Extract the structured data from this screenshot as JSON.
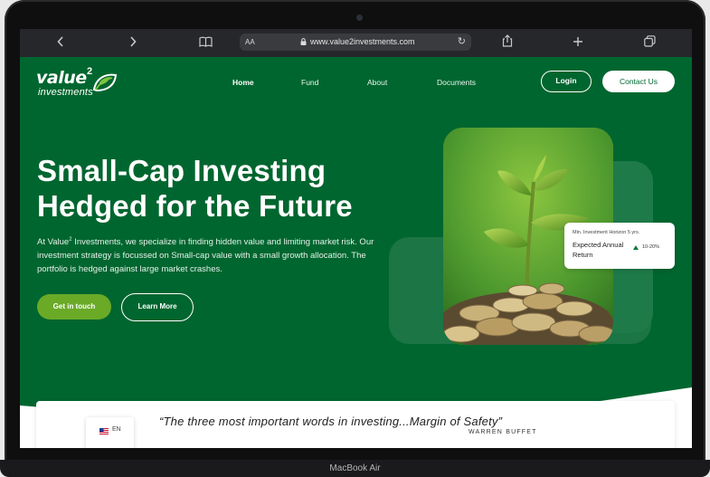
{
  "browser": {
    "text_size_label": "AA",
    "url": "www.value2investments.com"
  },
  "site": {
    "logo": {
      "word": "value",
      "sup": "2",
      "sub": "investments"
    },
    "nav": [
      {
        "label": "Home"
      },
      {
        "label": "Fund"
      },
      {
        "label": "About"
      },
      {
        "label": "Documents"
      }
    ],
    "login_label": "Login",
    "contact_label": "Contact Us"
  },
  "hero": {
    "title_line1": "Small-Cap Investing",
    "title_line2": "Hedged for the Future",
    "desc_pre": "At Value",
    "desc_sup": "2",
    "desc_post": " Investments, we specialize in finding hidden value and limiting market risk. Our investment strategy is focussed on Small-cap value with a small growth allocation. The portfolio is hedged against large market crashes.",
    "primary_button": "Get in touch",
    "secondary_button": "Learn More"
  },
  "stat_card": {
    "horizon": "Min. Investment Horizon 5 yrs.",
    "label": "Expected Annual Return",
    "range": "10-20%"
  },
  "quote": {
    "lang": "EN",
    "text": "“The three most important words in investing...Margin of Safety”",
    "author": "WARREN BUFFET"
  },
  "device": {
    "label": "MacBook Air"
  },
  "colors": {
    "brand_green": "#00662f",
    "accent_green": "#6aaa27"
  }
}
